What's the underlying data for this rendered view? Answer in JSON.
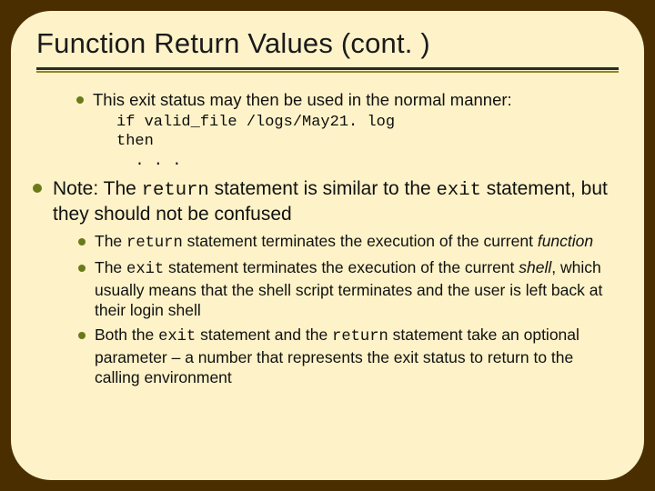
{
  "title": "Function Return Values (cont. )",
  "bullets": {
    "b1_lead": "This exit status may then be used in the normal manner:",
    "code_line1": "if valid_file /logs/May21. log",
    "code_line2": "then",
    "code_line3": ". . .",
    "b2_pre": "Note:  The ",
    "b2_return": "return",
    "b2_mid": " statement is similar to the ",
    "b2_exit": "exit",
    "b2_post": " statement, but they should not be confused",
    "s1_pre": "The ",
    "s1_return": "return",
    "s1_mid": " statement terminates the execution of the current ",
    "s1_ital": "function",
    "s2_pre": "The ",
    "s2_exit": "exit",
    "s2_mid": " statement terminates the execution of the current ",
    "s2_ital": "shell",
    "s2_post": ", which usually means that the shell script terminates and the user is left back at their login shell",
    "s3_pre": "Both the ",
    "s3_exit": "exit",
    "s3_mid1": " statement and the ",
    "s3_return": "return",
    "s3_post": " statement take an optional parameter – a number that represents the exit status to return to the calling environment"
  }
}
